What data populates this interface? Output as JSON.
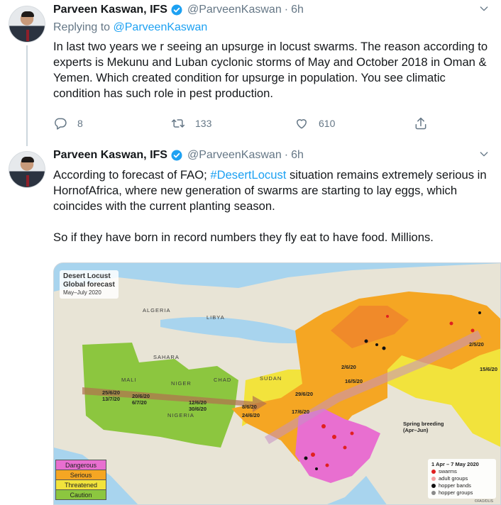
{
  "tweets": [
    {
      "author_name": "Parveen Kaswan, IFS",
      "handle": "@ParveenKaswan",
      "separator": "·",
      "time": "6h",
      "replying_prefix": "Replying to",
      "replying_to": "@ParveenKaswan",
      "text": "In last two years we r seeing an upsurge in locust swarms. The reason according to experts is Mekunu and Luban cyclonic storms of May and October 2018 in Oman & Yemen. Which created condition for upsurge in population. You see climatic condition has such role in pest production.",
      "replies": "8",
      "retweets": "133",
      "likes": "610"
    },
    {
      "author_name": "Parveen Kaswan, IFS",
      "handle": "@ParveenKaswan",
      "separator": "·",
      "time": "6h",
      "text_before_hashtag": "According to forecast of FAO; ",
      "hashtag": "#DesertLocust",
      "text_after_hashtag": " situation remains extremely serious in HornofAfrica, where new generation of swarms are starting to lay eggs, which coincides with the current planting season.\n\nSo if they have born in record numbers they fly eat to have food. Millions."
    }
  ],
  "map": {
    "title_line1": "Desert Locust",
    "title_line2": "Global forecast",
    "subtitle": "May–July 2020",
    "legend_levels": [
      {
        "label": "Dangerous",
        "color": "#e86fd0"
      },
      {
        "label": "Serious",
        "color": "#f5a623"
      },
      {
        "label": "Threatened",
        "color": "#f2e33c"
      },
      {
        "label": "Caution",
        "color": "#8cc63f"
      }
    ],
    "legend_period": "1 Apr – 7 May 2020",
    "legend_items": [
      {
        "label": "swarms",
        "color": "#e02020"
      },
      {
        "label": "adult groups",
        "color": "#f4a0a0"
      },
      {
        "label": "hopper bands",
        "color": "#111111"
      },
      {
        "label": "hopper groups",
        "color": "#8a8a8a"
      }
    ],
    "spring_breeding": "Spring breeding",
    "spring_breeding_period": "(Apr–Jun)",
    "place_labels": [
      "ALGERIA",
      "LIBYA",
      "SUDAN",
      "MALI",
      "NIGER",
      "CHAD",
      "NIGERIA",
      "SAHARA"
    ],
    "dates": [
      "25/6/20",
      "13/7/20",
      "20/6/20",
      "6/7/20",
      "12/6/20",
      "30/6/20",
      "8/6/20",
      "24/6/20",
      "17/6/20",
      "16/5/20",
      "2/6/20",
      "29/6/20",
      "2/5/20",
      "15/6/20"
    ],
    "credit": "©FAO/DLIS"
  },
  "colors": {
    "link": "#1da1f2",
    "muted": "#657786",
    "text": "#14171a"
  },
  "icons": [
    "verified-badge-icon",
    "chevron-down-icon",
    "reply-icon",
    "retweet-icon",
    "like-icon",
    "share-icon"
  ]
}
